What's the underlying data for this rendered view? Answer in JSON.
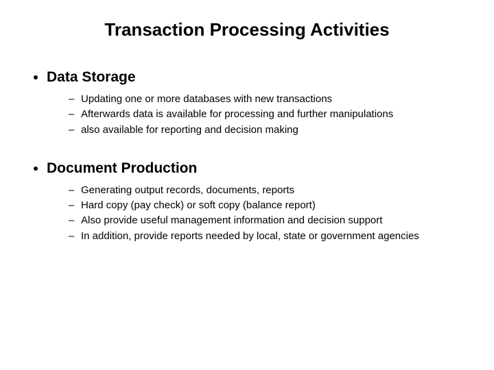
{
  "title": "Transaction Processing Activities",
  "sections": [
    {
      "heading": "Data Storage",
      "items": [
        "Updating one or more databases with new transactions",
        "Afterwards data is available for processing and further manipulations",
        "also available for reporting and decision making"
      ]
    },
    {
      "heading": "Document Production",
      "items": [
        "Generating output records, documents, reports",
        "Hard copy (pay check) or soft copy (balance report)",
        "Also provide useful management information and decision support",
        "In addition, provide reports needed by local, state or government agencies"
      ]
    }
  ]
}
